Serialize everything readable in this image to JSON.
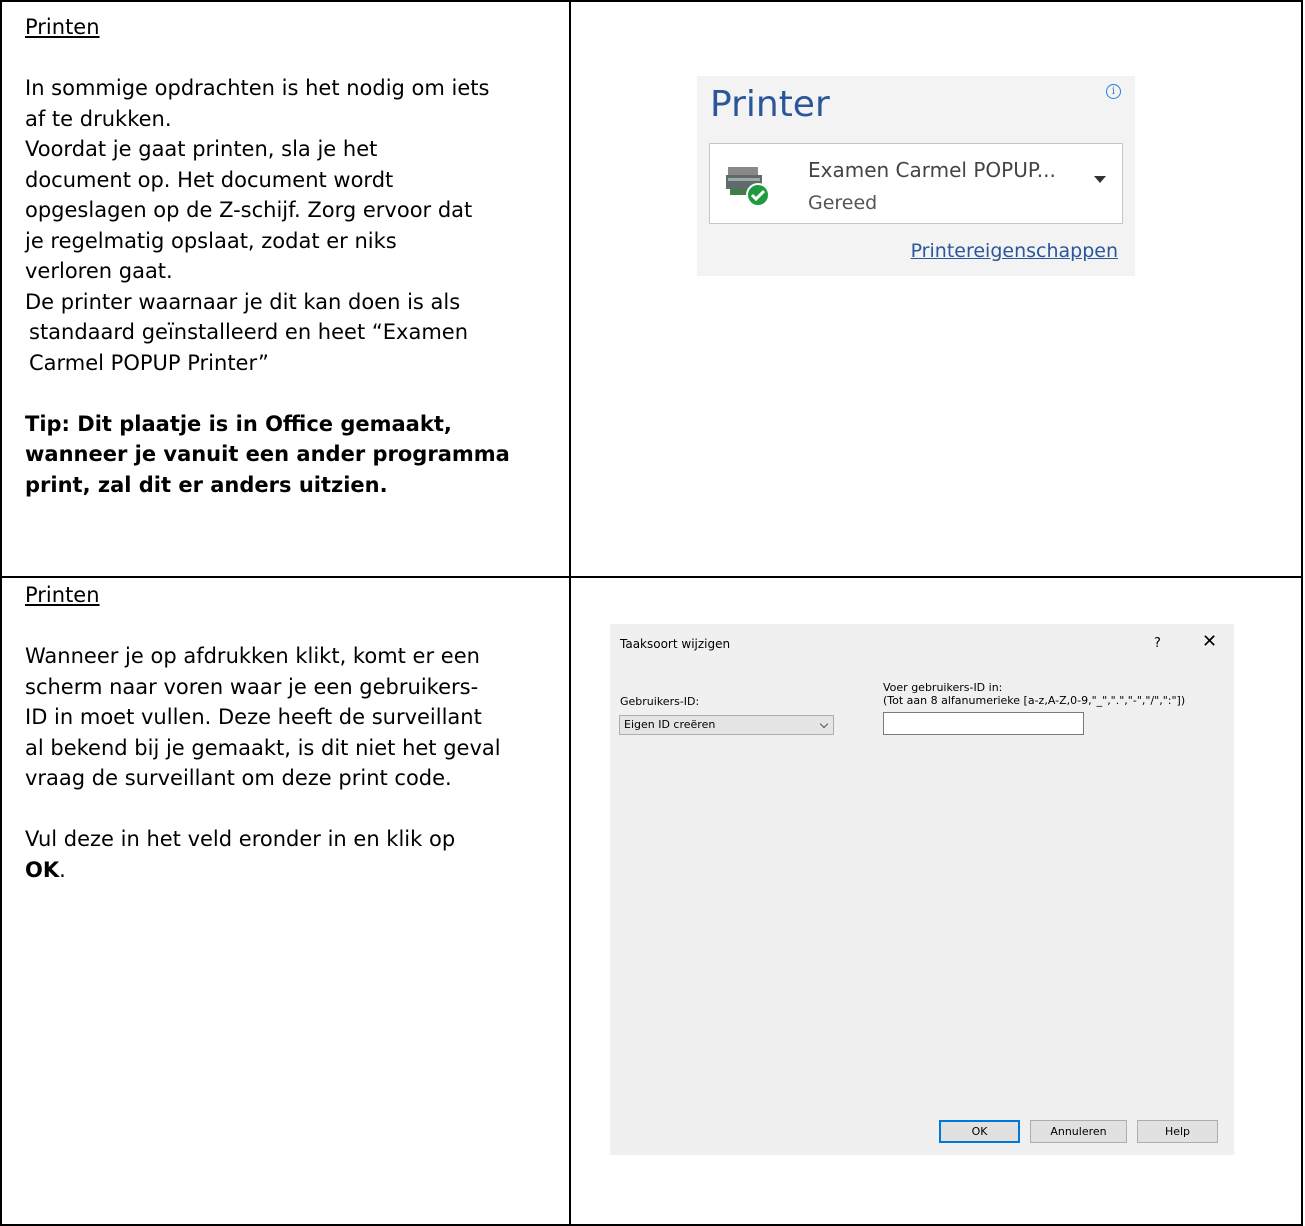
{
  "section1": {
    "heading": "Printen",
    "lines": [
      "In sommige opdrachten is het nodig om iets",
      "af te drukken.",
      "Voordat je gaat printen, sla je het",
      "document op. Het document wordt",
      "opgeslagen op de Z-schijf. Zorg ervoor dat",
      "je regelmatig opslaat, zodat er niks",
      "verloren gaat.",
      "De printer waarnaar je dit kan doen is als",
      "standaard geïnstalleerd en heet “Examen",
      "Carmel POPUP Printer”"
    ],
    "tip_lines": [
      "Tip: Dit plaatje is in Office gemaakt,",
      "wanneer je vanuit een ander programma",
      "print, zal dit er anders uitzien."
    ]
  },
  "printer_panel": {
    "title": "Printer",
    "info_icon": "i",
    "printer_name": "Examen Carmel POPUP...",
    "status": "Gereed",
    "properties_link": "Printereigenschappen"
  },
  "section2": {
    "heading": "Printen",
    "lines": [
      "Wanneer je op afdrukken klikt, komt er een",
      "scherm naar voren waar je een gebruikers-",
      "ID in moet vullen. Deze heeft de surveillant",
      "al bekend bij je gemaakt, is dit niet het geval",
      "vraag de surveillant om deze print code."
    ],
    "final_prefix": "Vul deze in het veld eronder in en klik op",
    "final_bold": "OK",
    "final_suffix": "."
  },
  "dialog": {
    "title": "Taaksoort wijzigen",
    "help_glyph": "?",
    "close_glyph": "✕",
    "user_id_label": "Gebruikers-ID:",
    "user_id_selected": "Eigen ID creëren",
    "enter_label_1": "Voer gebruikers-ID in:",
    "enter_label_2": "(Tot aan 8 alfanumerieke [a-z,A-Z,0-9,\"_\",\".\",\"-\",\"/\",\":\"])",
    "input_value": "",
    "ok_label": "OK",
    "cancel_label": "Annuleren",
    "help_label": "Help"
  },
  "colors": {
    "office_blue": "#2b579a",
    "dialog_bg": "#f0f0f0",
    "ok_border": "#0078d7",
    "check_green": "#1e9b3c"
  }
}
